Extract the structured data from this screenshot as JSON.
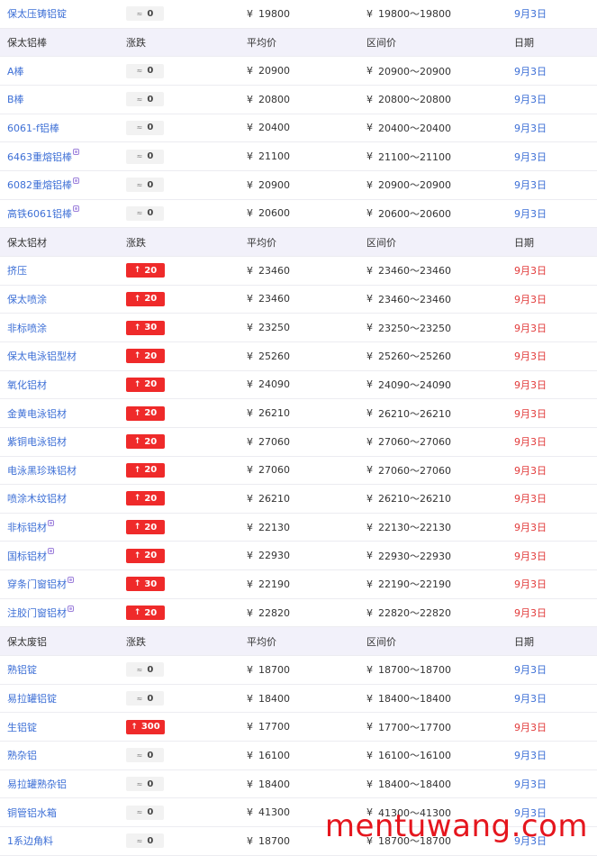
{
  "currency_symbol": "¥",
  "range_separator": "~",
  "top_row": {
    "name": "保太压铸铝锭",
    "change_text": "0",
    "change_dir": "flat",
    "avg": "19800",
    "low": "19800",
    "high": "19800",
    "date": "9月3日"
  },
  "sections": [
    {
      "headers": {
        "name": "保太铝棒",
        "change": "涨跌",
        "avg": "平均价",
        "range": "区间价",
        "date": "日期"
      },
      "rows": [
        {
          "name": "A棒",
          "change_text": "0",
          "change_dir": "flat",
          "avg": "20900",
          "low": "20900",
          "high": "20900",
          "date": "9月3日",
          "mark": false
        },
        {
          "name": "B棒",
          "change_text": "0",
          "change_dir": "flat",
          "avg": "20800",
          "low": "20800",
          "high": "20800",
          "date": "9月3日",
          "mark": false
        },
        {
          "name": "6061-f铝棒",
          "change_text": "0",
          "change_dir": "flat",
          "avg": "20400",
          "low": "20400",
          "high": "20400",
          "date": "9月3日",
          "mark": false
        },
        {
          "name": "6463重熔铝棒",
          "change_text": "0",
          "change_dir": "flat",
          "avg": "21100",
          "low": "21100",
          "high": "21100",
          "date": "9月3日",
          "mark": true
        },
        {
          "name": "6082重熔铝棒",
          "change_text": "0",
          "change_dir": "flat",
          "avg": "20900",
          "low": "20900",
          "high": "20900",
          "date": "9月3日",
          "mark": true
        },
        {
          "name": "高铁6061铝棒",
          "change_text": "0",
          "change_dir": "flat",
          "avg": "20600",
          "low": "20600",
          "high": "20600",
          "date": "9月3日",
          "mark": true
        }
      ]
    },
    {
      "headers": {
        "name": "保太铝材",
        "change": "涨跌",
        "avg": "平均价",
        "range": "区间价",
        "date": "日期"
      },
      "rows": [
        {
          "name": "挤压",
          "change_text": "20",
          "change_dir": "up",
          "avg": "23460",
          "low": "23460",
          "high": "23460",
          "date": "9月3日",
          "mark": false
        },
        {
          "name": "保太喷涂",
          "change_text": "20",
          "change_dir": "up",
          "avg": "23460",
          "low": "23460",
          "high": "23460",
          "date": "9月3日",
          "mark": false
        },
        {
          "name": "非标喷涂",
          "change_text": "30",
          "change_dir": "up",
          "avg": "23250",
          "low": "23250",
          "high": "23250",
          "date": "9月3日",
          "mark": false
        },
        {
          "name": "保太电泳铝型材",
          "change_text": "20",
          "change_dir": "up",
          "avg": "25260",
          "low": "25260",
          "high": "25260",
          "date": "9月3日",
          "mark": false
        },
        {
          "name": "氧化铝材",
          "change_text": "20",
          "change_dir": "up",
          "avg": "24090",
          "low": "24090",
          "high": "24090",
          "date": "9月3日",
          "mark": false
        },
        {
          "name": "金黄电泳铝材",
          "change_text": "20",
          "change_dir": "up",
          "avg": "26210",
          "low": "26210",
          "high": "26210",
          "date": "9月3日",
          "mark": false
        },
        {
          "name": "紫铜电泳铝材",
          "change_text": "20",
          "change_dir": "up",
          "avg": "27060",
          "low": "27060",
          "high": "27060",
          "date": "9月3日",
          "mark": false
        },
        {
          "name": "电泳黑珍珠铝材",
          "change_text": "20",
          "change_dir": "up",
          "avg": "27060",
          "low": "27060",
          "high": "27060",
          "date": "9月3日",
          "mark": false
        },
        {
          "name": "喷涂木纹铝材",
          "change_text": "20",
          "change_dir": "up",
          "avg": "26210",
          "low": "26210",
          "high": "26210",
          "date": "9月3日",
          "mark": false
        },
        {
          "name": "非标铝材",
          "change_text": "20",
          "change_dir": "up",
          "avg": "22130",
          "low": "22130",
          "high": "22130",
          "date": "9月3日",
          "mark": true
        },
        {
          "name": "国标铝材",
          "change_text": "20",
          "change_dir": "up",
          "avg": "22930",
          "low": "22930",
          "high": "22930",
          "date": "9月3日",
          "mark": true
        },
        {
          "name": "穿条门窗铝材",
          "change_text": "30",
          "change_dir": "up",
          "avg": "22190",
          "low": "22190",
          "high": "22190",
          "date": "9月3日",
          "mark": true
        },
        {
          "name": "注胶门窗铝材",
          "change_text": "20",
          "change_dir": "up",
          "avg": "22820",
          "low": "22820",
          "high": "22820",
          "date": "9月3日",
          "mark": true
        }
      ]
    },
    {
      "headers": {
        "name": "保太废铝",
        "change": "涨跌",
        "avg": "平均价",
        "range": "区间价",
        "date": "日期"
      },
      "rows": [
        {
          "name": "熟铝锭",
          "change_text": "0",
          "change_dir": "flat",
          "avg": "18700",
          "low": "18700",
          "high": "18700",
          "date": "9月3日",
          "mark": false
        },
        {
          "name": "易拉罐铝锭",
          "change_text": "0",
          "change_dir": "flat",
          "avg": "18400",
          "low": "18400",
          "high": "18400",
          "date": "9月3日",
          "mark": false
        },
        {
          "name": "生铝锭",
          "change_text": "300",
          "change_dir": "up",
          "avg": "17700",
          "low": "17700",
          "high": "17700",
          "date": "9月3日",
          "mark": false
        },
        {
          "name": "熟杂铝",
          "change_text": "0",
          "change_dir": "flat",
          "avg": "16100",
          "low": "16100",
          "high": "16100",
          "date": "9月3日",
          "mark": false
        },
        {
          "name": "易拉罐熟杂铝",
          "change_text": "0",
          "change_dir": "flat",
          "avg": "18400",
          "low": "18400",
          "high": "18400",
          "date": "9月3日",
          "mark": false
        },
        {
          "name": "铜管铝水箱",
          "change_text": "0",
          "change_dir": "flat",
          "avg": "41300",
          "low": "41300",
          "high": "41300",
          "date": "9月3日",
          "mark": false
        },
        {
          "name": "1系边角料",
          "change_text": "0",
          "change_dir": "flat",
          "avg": "18700",
          "low": "18700",
          "high": "18700",
          "date": "9月3日",
          "mark": false
        }
      ]
    }
  ],
  "icons": {
    "flat_change": "wave-icon",
    "up_change": "arrow-up-icon",
    "tag": "tag-icon"
  },
  "colors": {
    "link": "#3d6fd6",
    "up_badge": "#ef2a2a",
    "date_red": "#e23b3b",
    "header_bg": "#f2f1fa",
    "watermark": "#e5161e"
  },
  "watermark": "mentuwang.com"
}
